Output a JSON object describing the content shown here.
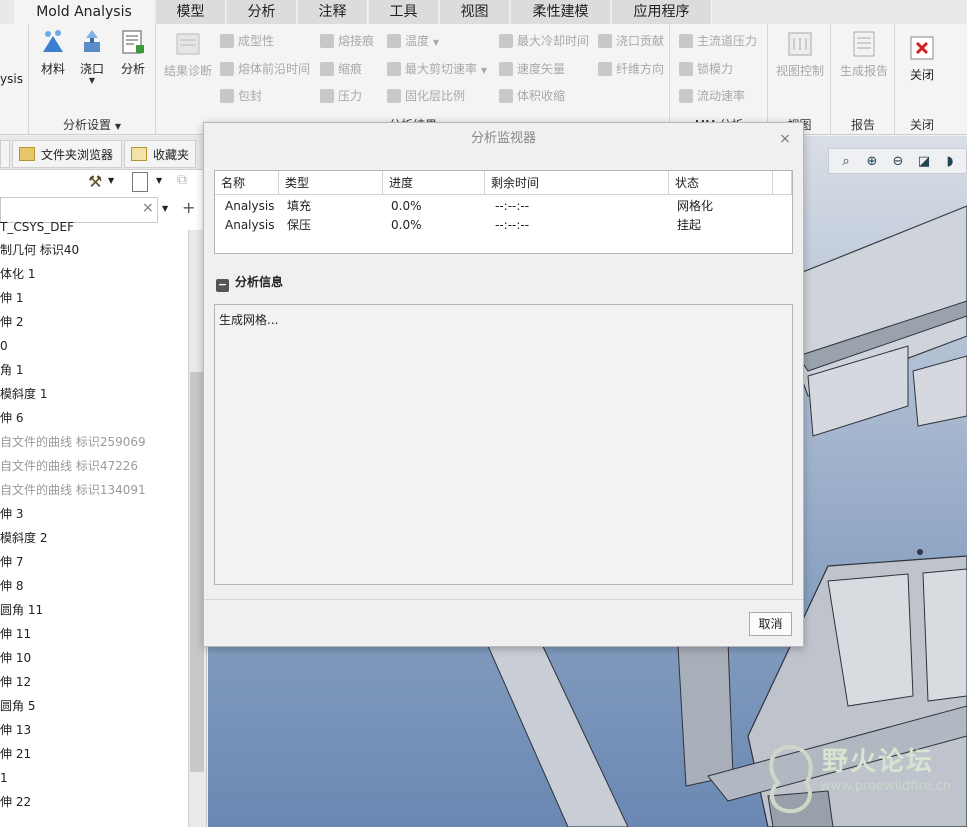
{
  "tabs": [
    "Mold Analysis",
    "模型",
    "分析",
    "注释",
    "工具",
    "视图",
    "柔性建模",
    "应用程序"
  ],
  "ribbon": {
    "analysis_cut": "ysis",
    "setup_buttons": [
      {
        "label": "材料",
        "icon": "material-icon"
      },
      {
        "label": "浇口",
        "icon": "gate-icon"
      },
      {
        "label": "分析",
        "icon": "analysis-icon"
      }
    ],
    "setup_group_label": "分析设置",
    "results_diag": "结果诊断",
    "results_col1": [
      "成型性",
      "熔体前沿时间",
      "包封"
    ],
    "results_col2": [
      "熔接痕",
      "缩痕",
      "压力"
    ],
    "results_col3": [
      "温度",
      "最大剪切速率",
      "固化层比例"
    ],
    "results_col4": [
      "最大冷却时间",
      "速度矢量",
      "体积收缩"
    ],
    "results_col5": [
      "浇口贡献",
      "纤维方向"
    ],
    "results_group_label": "分析结果",
    "mm_col": [
      "主流道压力",
      "锁模力",
      "流动速率"
    ],
    "mm_group_label": "MM 分析",
    "view_control": "视图控制",
    "view_group_label": "视图",
    "gen_report": "生成报告",
    "report_group_label": "报告",
    "close_label": "关闭",
    "close_group_label": "关闭"
  },
  "left_panel": {
    "tabs": [
      "文件夹浏览器",
      "收藏夹"
    ],
    "search_clear": "×",
    "tree": [
      {
        "text": "T_CSYS_DEF",
        "grey": false
      },
      {
        "text": "制几何 标识40",
        "grey": false
      },
      {
        "text": "体化 1",
        "grey": false
      },
      {
        "text": "伸 1",
        "grey": false
      },
      {
        "text": "伸 2",
        "grey": false
      },
      {
        "text": "0",
        "grey": false
      },
      {
        "text": "角 1",
        "grey": false
      },
      {
        "text": "模斜度 1",
        "grey": false
      },
      {
        "text": "伸 6",
        "grey": false
      },
      {
        "text": "自文件的曲线 标识259069",
        "grey": true
      },
      {
        "text": "自文件的曲线 标识47226",
        "grey": true
      },
      {
        "text": "自文件的曲线 标识134091",
        "grey": true
      },
      {
        "text": "伸 3",
        "grey": false
      },
      {
        "text": "模斜度 2",
        "grey": false
      },
      {
        "text": "伸 7",
        "grey": false
      },
      {
        "text": "伸 8",
        "grey": false
      },
      {
        "text": "圆角 11",
        "grey": false
      },
      {
        "text": "伸 11",
        "grey": false
      },
      {
        "text": "伸 10",
        "grey": false
      },
      {
        "text": "伸 12",
        "grey": false
      },
      {
        "text": "圆角 5",
        "grey": false
      },
      {
        "text": "伸 13",
        "grey": false
      },
      {
        "text": "伸 21",
        "grey": false
      },
      {
        "text": "1",
        "grey": false
      },
      {
        "text": "伸 22",
        "grey": false
      }
    ]
  },
  "dialog": {
    "title": "分析监视器",
    "close": "×",
    "columns": [
      "名称",
      "类型",
      "进度",
      "剩余时间",
      "状态"
    ],
    "rows": [
      {
        "name": "Analysis",
        "type": "填充",
        "progress": "0.0%",
        "remaining": "--:--:--",
        "status": "网格化"
      },
      {
        "name": "Analysis",
        "type": "保压",
        "progress": "0.0%",
        "remaining": "--:--:--",
        "status": "挂起"
      }
    ],
    "info_header": "分析信息",
    "info_collapse": "−",
    "info_text": "生成网格...",
    "cancel": "取消"
  },
  "watermark": {
    "title": "野火论坛",
    "url": "www.proewildfire.cn"
  },
  "colors": {
    "active_tab": "#f4f4f4",
    "viewport_top": "#d9dee6",
    "viewport_bottom": "#6a88b2",
    "close_red": "#d42020"
  }
}
